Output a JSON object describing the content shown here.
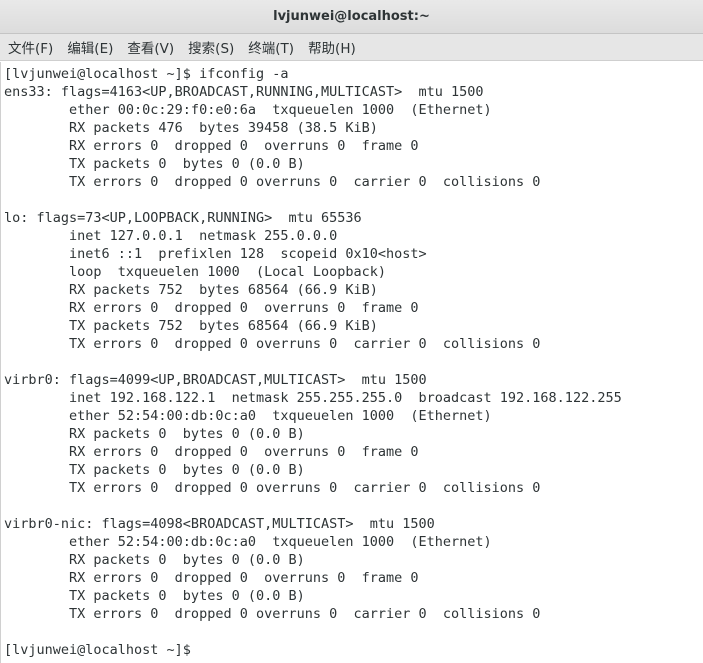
{
  "window": {
    "title": "lvjunwei@localhost:~"
  },
  "menubar": {
    "items": [
      "文件(F)",
      "编辑(E)",
      "查看(V)",
      "搜索(S)",
      "终端(T)",
      "帮助(H)"
    ]
  },
  "terminal": {
    "lines": [
      "[lvjunwei@localhost ~]$ ifconfig -a",
      "ens33: flags=4163<UP,BROADCAST,RUNNING,MULTICAST>  mtu 1500",
      "        ether 00:0c:29:f0:e0:6a  txqueuelen 1000  (Ethernet)",
      "        RX packets 476  bytes 39458 (38.5 KiB)",
      "        RX errors 0  dropped 0  overruns 0  frame 0",
      "        TX packets 0  bytes 0 (0.0 B)",
      "        TX errors 0  dropped 0 overruns 0  carrier 0  collisions 0",
      "",
      "lo: flags=73<UP,LOOPBACK,RUNNING>  mtu 65536",
      "        inet 127.0.0.1  netmask 255.0.0.0",
      "        inet6 ::1  prefixlen 128  scopeid 0x10<host>",
      "        loop  txqueuelen 1000  (Local Loopback)",
      "        RX packets 752  bytes 68564 (66.9 KiB)",
      "        RX errors 0  dropped 0  overruns 0  frame 0",
      "        TX packets 752  bytes 68564 (66.9 KiB)",
      "        TX errors 0  dropped 0 overruns 0  carrier 0  collisions 0",
      "",
      "virbr0: flags=4099<UP,BROADCAST,MULTICAST>  mtu 1500",
      "        inet 192.168.122.1  netmask 255.255.255.0  broadcast 192.168.122.255",
      "        ether 52:54:00:db:0c:a0  txqueuelen 1000  (Ethernet)",
      "        RX packets 0  bytes 0 (0.0 B)",
      "        RX errors 0  dropped 0  overruns 0  frame 0",
      "        TX packets 0  bytes 0 (0.0 B)",
      "        TX errors 0  dropped 0 overruns 0  carrier 0  collisions 0",
      "",
      "virbr0-nic: flags=4098<BROADCAST,MULTICAST>  mtu 1500",
      "        ether 52:54:00:db:0c:a0  txqueuelen 1000  (Ethernet)",
      "        RX packets 0  bytes 0 (0.0 B)",
      "        RX errors 0  dropped 0  overruns 0  frame 0",
      "        TX packets 0  bytes 0 (0.0 B)",
      "        TX errors 0  dropped 0 overruns 0  carrier 0  collisions 0",
      "",
      "[lvjunwei@localhost ~]$ "
    ]
  }
}
